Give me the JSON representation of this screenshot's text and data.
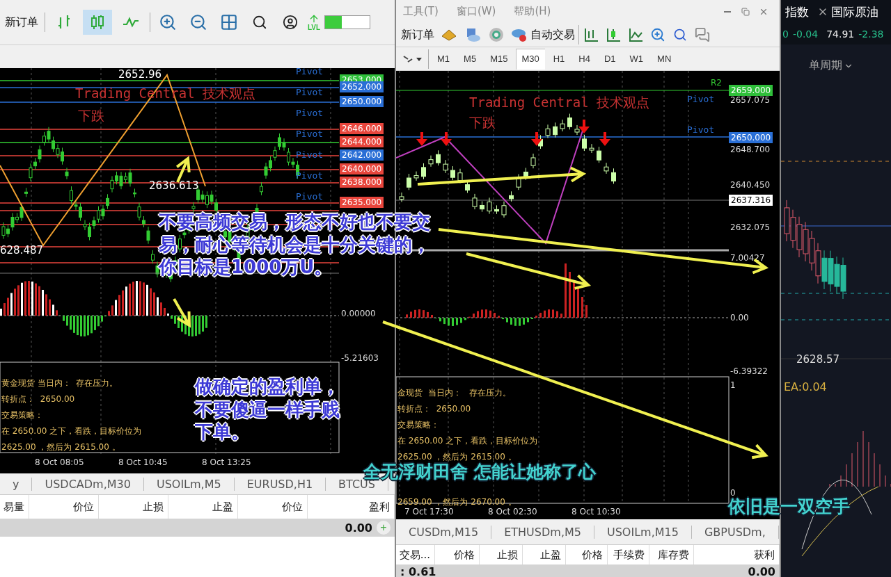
{
  "left_window": {
    "toolbar": {
      "new_order": "新订单",
      "chart_modes": [
        {
          "kind": "bars",
          "selected": false
        },
        {
          "kind": "candles",
          "selected": true
        },
        {
          "kind": "line",
          "selected": false
        }
      ],
      "level_label": "LVL",
      "level": 0.38
    },
    "chart": {
      "title": "Trading Central 技术观点",
      "direction": "下跌",
      "high_label": "2652.96",
      "low_label": "628.487",
      "last_label": "2636.613",
      "pivot_labels": [
        "Pivot",
        "Pivot",
        "Pivot",
        "Pivot",
        "Pivot",
        "Pivot",
        "Pivot"
      ],
      "price_tags": [
        {
          "text": "2653.000",
          "color": "#2fbf3a"
        },
        {
          "text": "2652.000",
          "color": "#2a6fd6"
        },
        {
          "text": "2650.000",
          "color": "#2a6fd6"
        },
        {
          "text": "2646.000",
          "color": "#e8453c"
        },
        {
          "text": "2644.000",
          "color": "#e8453c"
        },
        {
          "text": "2642.000",
          "color": "#2a6fd6"
        },
        {
          "text": "2640.000",
          "color": "#e8453c"
        },
        {
          "text": "2638.000",
          "color": "#e8453c"
        },
        {
          "text": "2635.000",
          "color": "#e8453c"
        }
      ],
      "macd_zero": "0.00000",
      "macd_min": "-5.21603",
      "info_lines": [
        "黄金现货 当日内：  存在压力。",
        "转折点：  2650.00",
        "交易策略：",
        "在 2650.00 之下，看跌，目标价位为",
        "2625.00 ，然后为 2615.00 。"
      ],
      "times": [
        "8 Oct 08:05",
        "8 Oct 10:45",
        "8 Oct 13:25"
      ]
    },
    "tabs": [
      "y",
      "USDCADm,M30",
      "USOILm,M5",
      "EURUSD,H1",
      "BTCUS"
    ],
    "table": {
      "columns": [
        "易量",
        "价位",
        "止损",
        "止盈",
        "价位",
        "盈利"
      ],
      "total": "0.00",
      "add_label": "+"
    }
  },
  "middle_window": {
    "menu": [
      "工具(T)",
      "窗口(W)",
      "帮助(H)"
    ],
    "toolbar": {
      "new_order": "新订单",
      "auto_trade": "自动交易"
    },
    "timeframes": [
      {
        "label": "M1",
        "selected": false
      },
      {
        "label": "M5",
        "selected": false
      },
      {
        "label": "M15",
        "selected": false
      },
      {
        "label": "M30",
        "selected": true
      },
      {
        "label": "H1",
        "selected": false
      },
      {
        "label": "H4",
        "selected": false
      },
      {
        "label": "D1",
        "selected": false
      },
      {
        "label": "W1",
        "selected": false
      },
      {
        "label": "MN",
        "selected": false
      }
    ],
    "chart": {
      "title": "Trading Central 技术观点",
      "direction": "下跌",
      "r2_label": "R2",
      "pivot_labels": [
        "Pivot",
        "Pivot"
      ],
      "axis_labels": [
        "2657.075",
        "2648.700",
        "2640.450",
        "2632.075",
        "7.00427",
        "0.00",
        "-6.39322",
        "1",
        "0"
      ],
      "price_tags": [
        {
          "text": "2659.000",
          "color": "#2fbf3a"
        },
        {
          "text": "2650.000",
          "color": "#2a6fd6"
        },
        {
          "text": "2637.316",
          "color": "#ffffff"
        }
      ],
      "info_lines": [
        "金现货  当日内：   存在压力。",
        "转折点：  2650.00",
        "交易策略：",
        "在 2650.00 之下，看跌，目标价位为",
        "2625.00 ，然后为 2615.00 。",
        "2659.00 ，然后为 2670.00 。"
      ],
      "times": [
        "7 Oct 17:30",
        "8 Oct 02:30",
        "8 Oct 10:30"
      ]
    },
    "tabs": [
      "CUSDm,M15",
      "ETHUSDm,M5",
      "USOILm,M15",
      "GBPUSDm,"
    ],
    "table": {
      "columns": [
        "交易...",
        "价格",
        "止损",
        "止盈",
        "价格",
        "手续费",
        "库存费",
        "获利"
      ],
      "balance": ": 0.61",
      "total": "0.00"
    }
  },
  "right_panel": {
    "tabs": [
      {
        "label": "指数",
        "closable": false
      },
      {
        "label": "国际原油",
        "closable": true
      }
    ],
    "quotes": [
      {
        "price": "0",
        "change": "-0.04"
      },
      {
        "price": "74.91",
        "change": "-2.38"
      }
    ],
    "period": "单周期",
    "last_price": "2628.57",
    "indicator": "EA:0.04"
  },
  "notes": [
    "不要高频交易，形态不好也不要交易，耐心等待机会是十分关键的，你目标是1000万U。",
    "做确定的盈利单，不要傻逼一样手贱下单。"
  ],
  "subtitles": [
    "全无浮财田舍 怎能让她称了心",
    "依旧是一双空手"
  ]
}
